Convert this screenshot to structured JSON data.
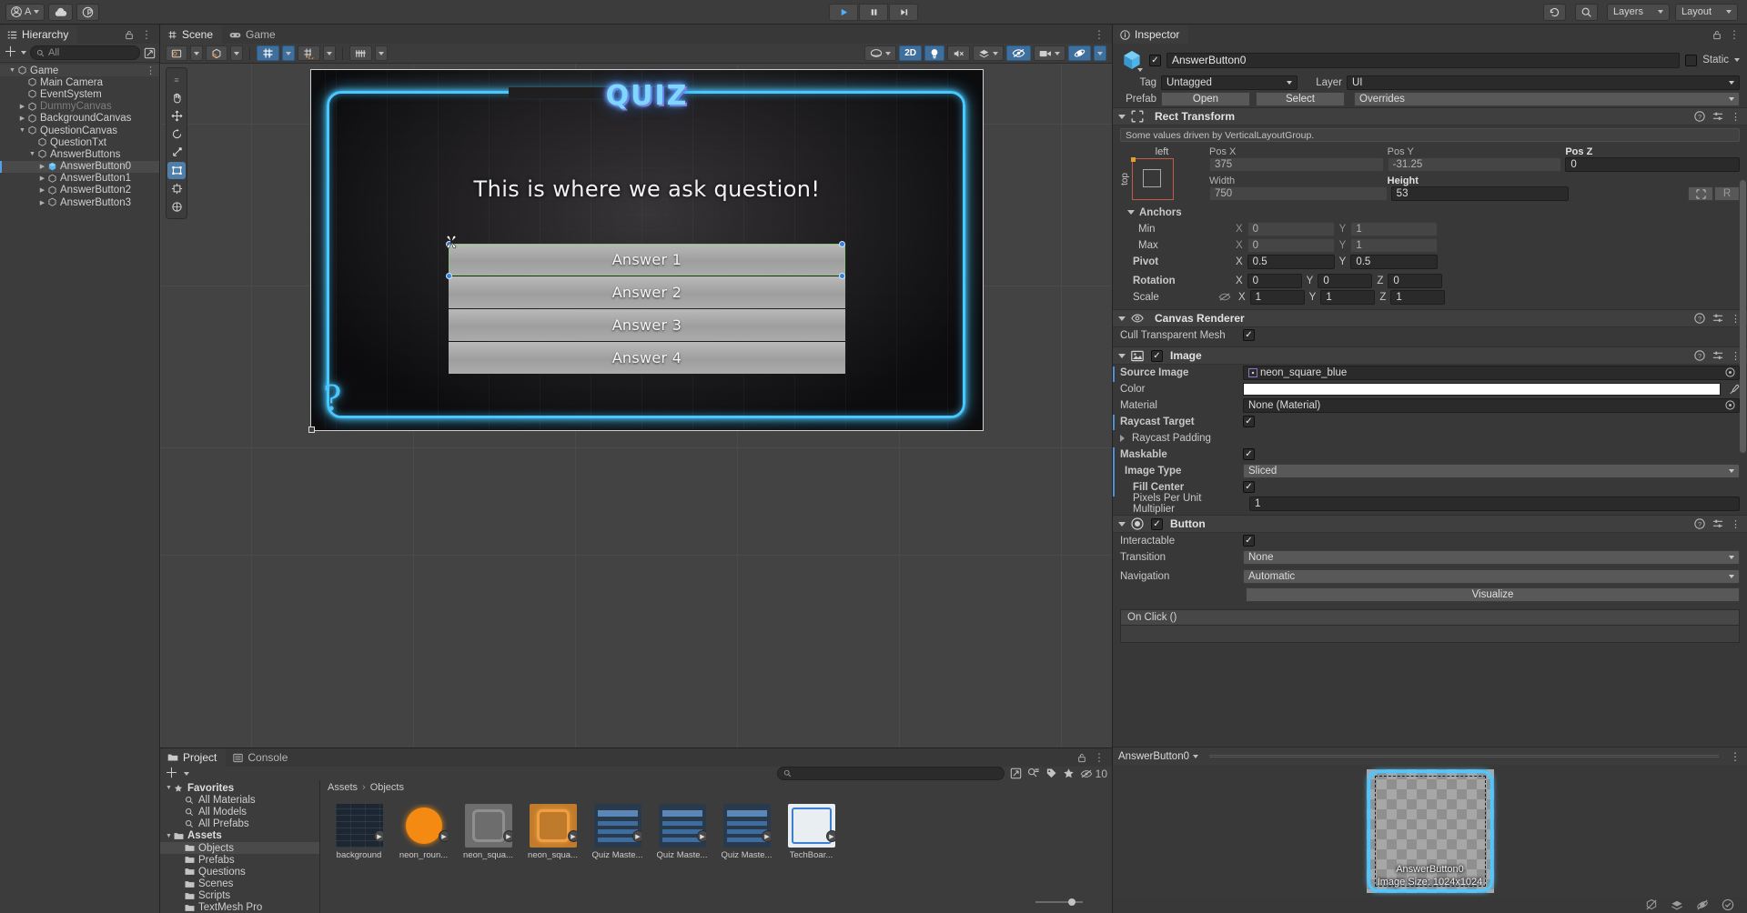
{
  "toolbar": {
    "account_label": "A",
    "cloud_icon": "cloud-icon",
    "collab_icon": "collab-icon",
    "play_icon": "play-icon",
    "pause_icon": "pause-icon",
    "step_icon": "step-icon",
    "history_icon": "history-icon",
    "search_icon": "search-icon",
    "layers_label": "Layers",
    "layout_label": "Layout"
  },
  "hierarchy": {
    "tab": "Hierarchy",
    "lock_icon": "lock-icon",
    "menu_icon": "kebab-menu-icon",
    "add_label": "+",
    "search_placeholder": "All",
    "items": [
      {
        "label": "Game",
        "indent": 0,
        "twist": "down",
        "selected": false,
        "dim": false,
        "root": true
      },
      {
        "label": "Main Camera",
        "indent": 1,
        "twist": "none",
        "selected": false,
        "dim": false
      },
      {
        "label": "EventSystem",
        "indent": 1,
        "twist": "none",
        "selected": false,
        "dim": false
      },
      {
        "label": "DummyCanvas",
        "indent": 1,
        "twist": "right",
        "selected": false,
        "dim": true
      },
      {
        "label": "BackgroundCanvas",
        "indent": 1,
        "twist": "right",
        "selected": false,
        "dim": false
      },
      {
        "label": "QuestionCanvas",
        "indent": 1,
        "twist": "down",
        "selected": false,
        "dim": false
      },
      {
        "label": "QuestionTxt",
        "indent": 2,
        "twist": "none",
        "selected": false,
        "dim": false
      },
      {
        "label": "AnswerButtons",
        "indent": 2,
        "twist": "down",
        "selected": false,
        "dim": false
      },
      {
        "label": "AnswerButton0",
        "indent": 3,
        "twist": "right",
        "selected": true,
        "dim": false
      },
      {
        "label": "AnswerButton1",
        "indent": 3,
        "twist": "right",
        "selected": false,
        "dim": false
      },
      {
        "label": "AnswerButton2",
        "indent": 3,
        "twist": "right",
        "selected": false,
        "dim": false
      },
      {
        "label": "AnswerButton3",
        "indent": 3,
        "twist": "right",
        "selected": false,
        "dim": false
      }
    ]
  },
  "scene": {
    "tabs": [
      {
        "label": "Scene",
        "icon": "grid-icon",
        "active": true
      },
      {
        "label": "Game",
        "icon": "gamepad-icon",
        "active": false
      }
    ],
    "menu_icon": "kebab-menu-icon",
    "toolbar": {
      "shading_icon": "shading-mode-icon",
      "gizmo_icon": "2d-gizmo-icon",
      "grid_icon": "grid-visibility-icon",
      "grid_snap_icon": "grid-snap-icon",
      "component_icon": "component-tools-icon",
      "toggle_2d": "2D",
      "light_icon": "light-icon",
      "audio_icon": "audio-mute-icon",
      "fx_icon": "effects-icon",
      "hidden_icon": "scene-visibility-icon",
      "camera_icon": "camera-icon",
      "gizmos_icon": "gizmos-icon"
    },
    "tools": [
      "hand-tool",
      "move-tool",
      "rotate-tool",
      "scale-tool",
      "rect-tool",
      "transform-tool",
      "custom-tool"
    ],
    "active_tool": "rect-tool"
  },
  "game_view": {
    "title": "QUIZ",
    "question": "This is where we ask question!",
    "answers": [
      "Answer 1",
      "Answer 2",
      "Answer 3",
      "Answer 4"
    ],
    "question_mark": "?",
    "neon_color": "#49c8ff",
    "selected_index": 0
  },
  "project": {
    "tabs": [
      {
        "label": "Project",
        "icon": "folder-icon",
        "active": true
      },
      {
        "label": "Console",
        "icon": "console-icon",
        "active": false
      }
    ],
    "lock_icon": "lock-icon",
    "menu_icon": "kebab-menu-icon",
    "add_label": "+",
    "search_placeholder": "",
    "hidden_count": "10",
    "breadcrumb": [
      "Assets",
      "Objects"
    ],
    "tree": [
      {
        "label": "Favorites",
        "indent": 0,
        "twist": "down",
        "bold": true,
        "icon": "star-icon",
        "selected": false
      },
      {
        "label": "All Materials",
        "indent": 1,
        "twist": "none",
        "bold": false,
        "icon": "search-icon",
        "selected": false
      },
      {
        "label": "All Models",
        "indent": 1,
        "twist": "none",
        "bold": false,
        "icon": "search-icon",
        "selected": false
      },
      {
        "label": "All Prefabs",
        "indent": 1,
        "twist": "none",
        "bold": false,
        "icon": "search-icon",
        "selected": false
      },
      {
        "label": "Assets",
        "indent": 0,
        "twist": "down",
        "bold": true,
        "icon": "folder-icon",
        "selected": false
      },
      {
        "label": "Objects",
        "indent": 1,
        "twist": "none",
        "bold": false,
        "icon": "folder-icon",
        "selected": true
      },
      {
        "label": "Prefabs",
        "indent": 1,
        "twist": "none",
        "bold": false,
        "icon": "folder-icon",
        "selected": false
      },
      {
        "label": "Questions",
        "indent": 1,
        "twist": "none",
        "bold": false,
        "icon": "folder-icon",
        "selected": false
      },
      {
        "label": "Scenes",
        "indent": 1,
        "twist": "none",
        "bold": false,
        "icon": "folder-icon",
        "selected": false
      },
      {
        "label": "Scripts",
        "indent": 1,
        "twist": "none",
        "bold": false,
        "icon": "folder-icon",
        "selected": false
      },
      {
        "label": "TextMesh Pro",
        "indent": 1,
        "twist": "none",
        "bold": false,
        "icon": "folder-icon",
        "selected": false
      }
    ],
    "assets": [
      {
        "name": "background",
        "kind": "bricks"
      },
      {
        "name": "neon_roun...",
        "kind": "orange-circle"
      },
      {
        "name": "neon_squa...",
        "kind": "grey-square"
      },
      {
        "name": "neon_squa...",
        "kind": "orange-square"
      },
      {
        "name": "Quiz Maste...",
        "kind": "sheet"
      },
      {
        "name": "Quiz Maste...",
        "kind": "sheet"
      },
      {
        "name": "Quiz Maste...",
        "kind": "sheet"
      },
      {
        "name": "TechBoar...",
        "kind": "board"
      }
    ]
  },
  "inspector": {
    "tab": "Inspector",
    "lock_icon": "lock-icon",
    "menu_icon": "kebab-menu-icon",
    "object_name": "AnswerButton0",
    "enabled": true,
    "static_label": "Static",
    "tag_label": "Tag",
    "tag_value": "Untagged",
    "layer_label": "Layer",
    "layer_value": "UI",
    "prefab_label": "Prefab",
    "prefab_open": "Open",
    "prefab_select": "Select",
    "prefab_overrides": "Overrides",
    "rect_transform": {
      "title": "Rect Transform",
      "driven_note": "Some values driven by VerticalLayoutGroup.",
      "anchor_preset_top": "top",
      "anchor_preset_left": "left",
      "pos_x_label": "Pos X",
      "pos_x": "375",
      "pos_y_label": "Pos Y",
      "pos_y": "-31.25",
      "pos_z_label": "Pos Z",
      "pos_z": "0",
      "width_label": "Width",
      "width": "750",
      "height_label": "Height",
      "height": "53",
      "blueprint_btn": "blueprint-mode-icon",
      "raw_btn": "R",
      "anchors_label": "Anchors",
      "min_label": "Min",
      "min_x": "0",
      "min_y": "1",
      "max_label": "Max",
      "max_x": "0",
      "max_y": "1",
      "pivot_label": "Pivot",
      "pivot_x": "0.5",
      "pivot_y": "0.5",
      "rotation_label": "Rotation",
      "rot_x": "0",
      "rot_y": "0",
      "rot_z": "0",
      "scale_label": "Scale",
      "scale_x": "1",
      "scale_y": "1",
      "scale_z": "1"
    },
    "canvas_renderer": {
      "title": "Canvas Renderer",
      "cull_label": "Cull Transparent Mesh",
      "cull_checked": true
    },
    "image": {
      "title": "Image",
      "enabled": true,
      "source_label": "Source Image",
      "source_value": "neon_square_blue",
      "color_label": "Color",
      "color_value": "#FFFFFF",
      "material_label": "Material",
      "material_value": "None (Material)",
      "raycast_label": "Raycast Target",
      "raycast_checked": true,
      "raycast_padding_label": "Raycast Padding",
      "maskable_label": "Maskable",
      "maskable_checked": true,
      "image_type_label": "Image Type",
      "image_type_value": "Sliced",
      "fill_center_label": "Fill Center",
      "fill_center_checked": true,
      "ppu_label": "Pixels Per Unit Multiplier",
      "ppu_value": "1"
    },
    "button": {
      "title": "Button",
      "enabled": true,
      "interactable_label": "Interactable",
      "interactable_checked": true,
      "transition_label": "Transition",
      "transition_value": "None",
      "navigation_label": "Navigation",
      "navigation_value": "Automatic",
      "visualize_label": "Visualize",
      "onclick_label": "On Click ()"
    },
    "preview": {
      "dropdown_label": "AnswerButton0",
      "menu_icon": "kebab-menu-icon",
      "name": "AnswerButton0",
      "size_label": "Image Size: 1024x1024"
    }
  },
  "statusbar": {
    "icons": [
      "no-collider-icon",
      "layers-icon",
      "no-gizmo-icon",
      "check-circle-icon"
    ]
  }
}
